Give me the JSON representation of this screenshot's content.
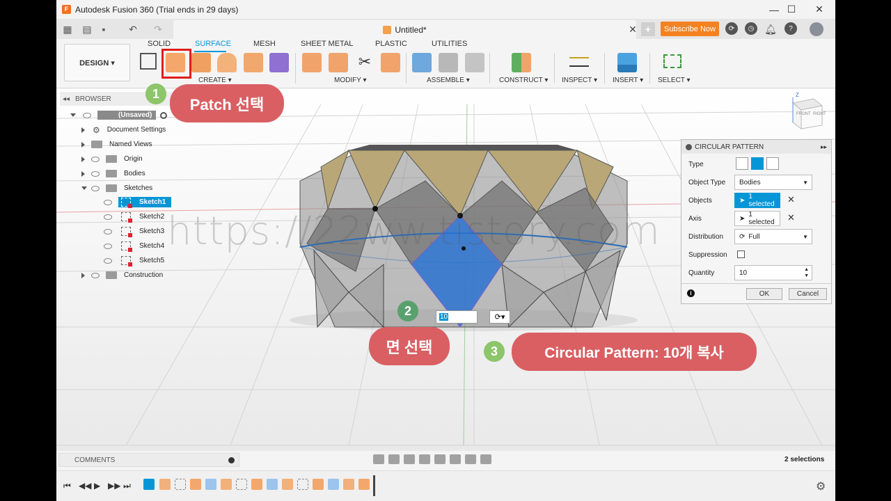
{
  "window": {
    "title": "Autodesk Fusion 360 (Trial ends in 29 days)",
    "min": "—",
    "max": "☐",
    "close": "✕"
  },
  "tabbar": {
    "doc_title": "Untitled*",
    "subscribe": "Subscribe Now"
  },
  "toolbar": {
    "design": "DESIGN ▾",
    "tabs": [
      "SOLID",
      "SURFACE",
      "MESH",
      "SHEET METAL",
      "PLASTIC",
      "UTILITIES"
    ],
    "groups": [
      "CREATE ▾",
      "MODIFY ▾",
      "ASSEMBLE ▾",
      "CONSTRUCT ▾",
      "INSPECT ▾",
      "INSERT ▾",
      "SELECT ▾"
    ]
  },
  "browser": {
    "header": "BROWSER",
    "root": "(Unsaved)",
    "items": [
      "Document Settings",
      "Named Views",
      "Origin",
      "Bodies",
      "Sketches",
      "Sketch1",
      "Sketch2",
      "Sketch3",
      "Sketch4",
      "Sketch5",
      "Construction"
    ]
  },
  "viewcube": {
    "front": "FRONT",
    "right": "RIGHT",
    "axis": "Z"
  },
  "dialog": {
    "title": "CIRCULAR PATTERN",
    "type_label": "Type",
    "object_type_label": "Object Type",
    "object_type_value": "Bodies",
    "objects_label": "Objects",
    "objects_value": "1 selected",
    "axis_label": "Axis",
    "axis_value": "1 selected",
    "distribution_label": "Distribution",
    "distribution_value": "Full",
    "suppression_label": "Suppression",
    "quantity_label": "Quantity",
    "quantity_value": "10",
    "ok": "OK",
    "cancel": "Cancel"
  },
  "inline_input": {
    "value": "10"
  },
  "status": {
    "comments": "COMMENTS",
    "selections": "2 selections"
  },
  "watermark": "https://22ww.tistory.com",
  "callouts": {
    "c1": {
      "num": "1",
      "text": "Patch 선택"
    },
    "c2": {
      "num": "2",
      "text": "면 선택"
    },
    "c3": {
      "num": "3",
      "text": "Circular Pattern: 10개 복사"
    }
  },
  "colors": {
    "accent": "#0696d7",
    "callout": "#d95f63",
    "badge": "#8cc56a",
    "highlight": "#e31c1c"
  }
}
